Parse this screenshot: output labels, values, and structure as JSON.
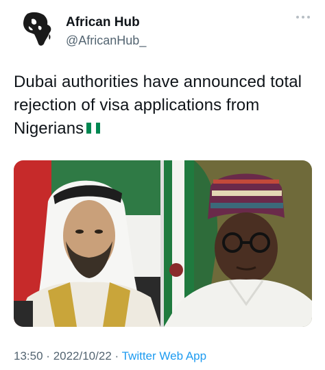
{
  "author": {
    "name": "African Hub",
    "handle": "@AfricanHub_"
  },
  "tweet": {
    "text": "Dubai authorities have announced total rejection of visa applications from Nigerians",
    "emoji": "nigeria-flag-icon"
  },
  "meta": {
    "time": "13:50",
    "separator": "·",
    "date": "2022/10/22",
    "source": "Twitter Web App"
  },
  "colors": {
    "text": "#0f1419",
    "secondary": "#536471",
    "link": "#1d9bf0",
    "nigeria_green": "#008751"
  },
  "media": {
    "photos": [
      "portrait-man-white-ghutra",
      "portrait-man-patterned-cap"
    ]
  }
}
